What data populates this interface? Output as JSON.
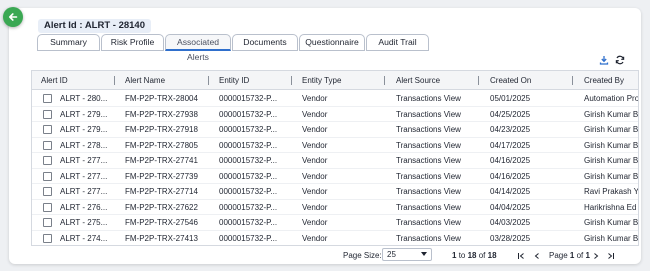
{
  "header": {
    "alert_id_label": "Alert Id : ALRT - 28140"
  },
  "tabs": [
    {
      "label": "Summary",
      "active": false
    },
    {
      "label": "Risk Profile",
      "active": false
    },
    {
      "label": "Associated Alerts",
      "active": true
    },
    {
      "label": "Documents",
      "active": false
    },
    {
      "label": "Questionnaire",
      "active": false
    },
    {
      "label": "Audit Trail",
      "active": false
    }
  ],
  "toolbar": {
    "icons": [
      "download-icon",
      "refresh-icon"
    ]
  },
  "table": {
    "columns": [
      "Alert ID",
      "Alert Name",
      "Entity ID",
      "Entity Type",
      "Alert Source",
      "Created On",
      "Created By"
    ],
    "rows": [
      [
        "ALRT - 280...",
        "FM-P2P-TRX-28004",
        "0000015732-P...",
        "Vendor",
        "Transactions View",
        "05/01/2025",
        "Automation Pro"
      ],
      [
        "ALRT - 279...",
        "FM-P2P-TRX-27938",
        "0000015732-P...",
        "Vendor",
        "Transactions View",
        "04/25/2025",
        "Girish Kumar B"
      ],
      [
        "ALRT - 279...",
        "FM-P2P-TRX-27918",
        "0000015732-P...",
        "Vendor",
        "Transactions View",
        "04/23/2025",
        "Girish Kumar B"
      ],
      [
        "ALRT - 278...",
        "FM-P2P-TRX-27805",
        "0000015732-P...",
        "Vendor",
        "Transactions View",
        "04/17/2025",
        "Girish Kumar B"
      ],
      [
        "ALRT - 277...",
        "FM-P2P-TRX-27741",
        "0000015732-P...",
        "Vendor",
        "Transactions View",
        "04/16/2025",
        "Girish Kumar B"
      ],
      [
        "ALRT - 277...",
        "FM-P2P-TRX-27739",
        "0000015732-P...",
        "Vendor",
        "Transactions View",
        "04/16/2025",
        "Girish Kumar B"
      ],
      [
        "ALRT - 277...",
        "FM-P2P-TRX-27714",
        "0000015732-P...",
        "Vendor",
        "Transactions View",
        "04/14/2025",
        "Ravi Prakash Y"
      ],
      [
        "ALRT - 276...",
        "FM-P2P-TRX-27622",
        "0000015732-P...",
        "Vendor",
        "Transactions View",
        "04/04/2025",
        "Harikrishna Ed"
      ],
      [
        "ALRT - 275...",
        "FM-P2P-TRX-27546",
        "0000015732-P...",
        "Vendor",
        "Transactions View",
        "04/03/2025",
        "Girish Kumar B"
      ],
      [
        "ALRT - 274...",
        "FM-P2P-TRX-27413",
        "0000015732-P...",
        "Vendor",
        "Transactions View",
        "03/28/2025",
        "Girish Kumar B"
      ]
    ]
  },
  "pagination": {
    "page_size_label": "Page Size:",
    "page_size_value": "25",
    "range_from": "1",
    "range_to_word": "to",
    "range_to": "18",
    "range_of_word": "of",
    "range_total": "18",
    "page_word": "Page",
    "page_current": "1",
    "page_of_word": "of",
    "page_total": "1"
  },
  "colors": {
    "accent": "#2f6fcc",
    "back_button": "#3aa853"
  }
}
